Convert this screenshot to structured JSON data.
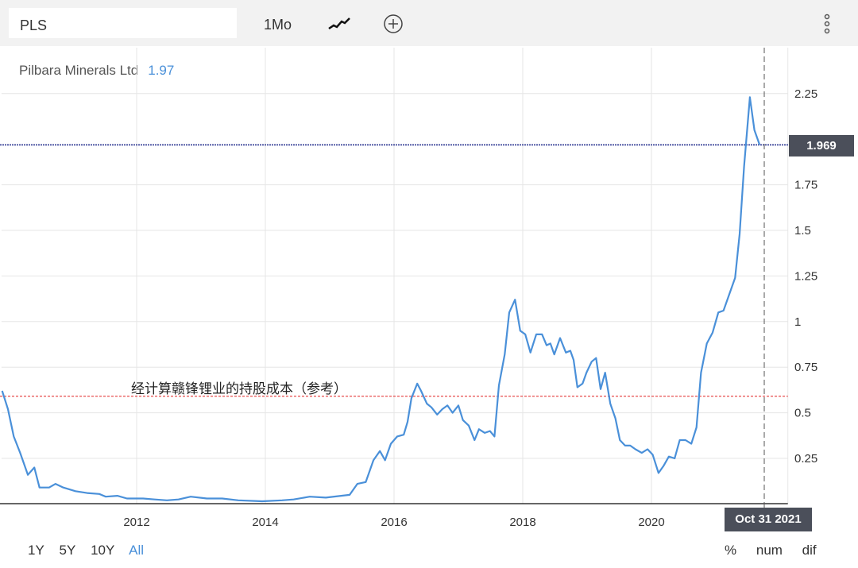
{
  "toolbar": {
    "symbol": "PLS",
    "frequency": "1Mo",
    "chart_type_icon": "line-chart-icon",
    "add_icon": "plus-circle-icon",
    "menu_icon": "vertical-dots-icon"
  },
  "header": {
    "name": "Pilbara Minerals Ltd",
    "last_value": "1.97"
  },
  "price_badge": "1.969",
  "date_badge": "Oct 31 2021",
  "ranges": [
    "1Y",
    "5Y",
    "10Y",
    "All"
  ],
  "active_range": "All",
  "modes": [
    "%",
    "num",
    "dif"
  ],
  "annotation": "经计算赣锋锂业的持股成本（参考）",
  "colors": {
    "line": "#4a90d9",
    "reference": "#e02020",
    "current": "#1f2a8a"
  },
  "chart_data": {
    "type": "line",
    "title": "Pilbara Minerals Ltd",
    "xlabel": "",
    "ylabel": "",
    "xlim": [
      2009.9,
      2022.12
    ],
    "ylim": [
      0,
      2.4
    ],
    "x_ticks": [
      "2012",
      "2014",
      "2016",
      "2018",
      "2020"
    ],
    "y_ticks": [
      "0.25",
      "0.5",
      "0.75",
      "1",
      "1.25",
      "1.5",
      "1.75",
      "2.25"
    ],
    "grid": true,
    "reference_line": 0.59,
    "current_value": 1.969,
    "cursor_date": 2021.83,
    "x": [
      2009.91,
      2010.0,
      2010.09,
      2010.19,
      2010.31,
      2010.41,
      2010.49,
      2010.64,
      2010.74,
      2010.86,
      2011.05,
      2011.23,
      2011.42,
      2011.52,
      2011.7,
      2011.85,
      2012.1,
      2012.28,
      2012.47,
      2012.65,
      2012.84,
      2013.09,
      2013.33,
      2013.58,
      2013.95,
      2014.26,
      2014.44,
      2014.69,
      2014.94,
      2015.31,
      2015.43,
      2015.56,
      2015.68,
      2015.78,
      2015.86,
      2015.95,
      2016.05,
      2016.15,
      2016.21,
      2016.27,
      2016.36,
      2016.42,
      2016.51,
      2016.58,
      2016.67,
      2016.75,
      2016.83,
      2016.91,
      2017.0,
      2017.07,
      2017.16,
      2017.25,
      2017.32,
      2017.41,
      2017.49,
      2017.56,
      2017.63,
      2017.72,
      2017.79,
      2017.88,
      2017.96,
      2018.04,
      2018.12,
      2018.21,
      2018.3,
      2018.37,
      2018.43,
      2018.49,
      2018.58,
      2018.67,
      2018.74,
      2018.79,
      2018.85,
      2018.93,
      2018.99,
      2019.07,
      2019.14,
      2019.21,
      2019.28,
      2019.36,
      2019.44,
      2019.51,
      2019.59,
      2019.67,
      2019.75,
      2019.85,
      2019.94,
      2020.02,
      2020.11,
      2020.19,
      2020.27,
      2020.36,
      2020.44,
      2020.53,
      2020.62,
      2020.7,
      2020.77,
      2020.86,
      2020.95,
      2021.04,
      2021.12,
      2021.21,
      2021.3,
      2021.37,
      2021.44,
      2021.53,
      2021.6,
      2021.68
    ],
    "values": [
      0.62,
      0.52,
      0.37,
      0.28,
      0.16,
      0.2,
      0.09,
      0.09,
      0.11,
      0.09,
      0.07,
      0.06,
      0.055,
      0.04,
      0.045,
      0.03,
      0.03,
      0.025,
      0.02,
      0.025,
      0.04,
      0.03,
      0.03,
      0.02,
      0.015,
      0.02,
      0.025,
      0.04,
      0.035,
      0.05,
      0.11,
      0.12,
      0.24,
      0.29,
      0.24,
      0.33,
      0.37,
      0.38,
      0.45,
      0.58,
      0.66,
      0.62,
      0.55,
      0.53,
      0.49,
      0.52,
      0.54,
      0.5,
      0.54,
      0.46,
      0.43,
      0.35,
      0.41,
      0.39,
      0.4,
      0.37,
      0.65,
      0.82,
      1.05,
      1.12,
      0.95,
      0.93,
      0.83,
      0.93,
      0.93,
      0.87,
      0.88,
      0.82,
      0.91,
      0.83,
      0.84,
      0.79,
      0.64,
      0.66,
      0.72,
      0.78,
      0.8,
      0.63,
      0.72,
      0.55,
      0.47,
      0.35,
      0.32,
      0.32,
      0.3,
      0.28,
      0.3,
      0.27,
      0.17,
      0.21,
      0.26,
      0.25,
      0.35,
      0.35,
      0.33,
      0.42,
      0.72,
      0.88,
      0.94,
      1.05,
      1.06,
      1.15,
      1.24,
      1.48,
      1.85,
      2.23,
      2.05,
      1.97
    ]
  }
}
